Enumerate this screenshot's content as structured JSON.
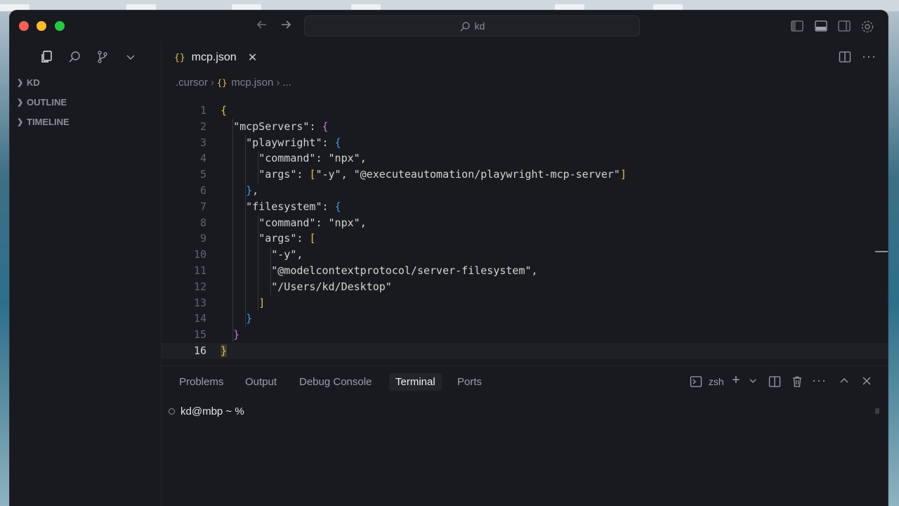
{
  "window": {
    "search_text": "kd"
  },
  "sidebar": {
    "sections": [
      {
        "label": "KD"
      },
      {
        "label": "OUTLINE"
      },
      {
        "label": "TIMELINE"
      }
    ]
  },
  "editor": {
    "tab_label": "mcp.json",
    "breadcrumb": {
      "folder": ".cursor",
      "file": "mcp.json",
      "more": "..."
    },
    "line_numbers": [
      "1",
      "2",
      "3",
      "4",
      "5",
      "6",
      "7",
      "8",
      "9",
      "10",
      "11",
      "12",
      "13",
      "14",
      "15",
      "16"
    ],
    "current_line": 16
  },
  "panel": {
    "tabs": [
      "Problems",
      "Output",
      "Debug Console",
      "Terminal",
      "Ports"
    ],
    "active_tab": "Terminal",
    "shell_label": "zsh",
    "prompt": "kd@mbp ~ %"
  },
  "colors": {
    "window_bg": "#181a1f",
    "brace_yellow": "#e2c05b",
    "brace_purple": "#c678dd",
    "brace_blue": "#3d9ee6"
  }
}
